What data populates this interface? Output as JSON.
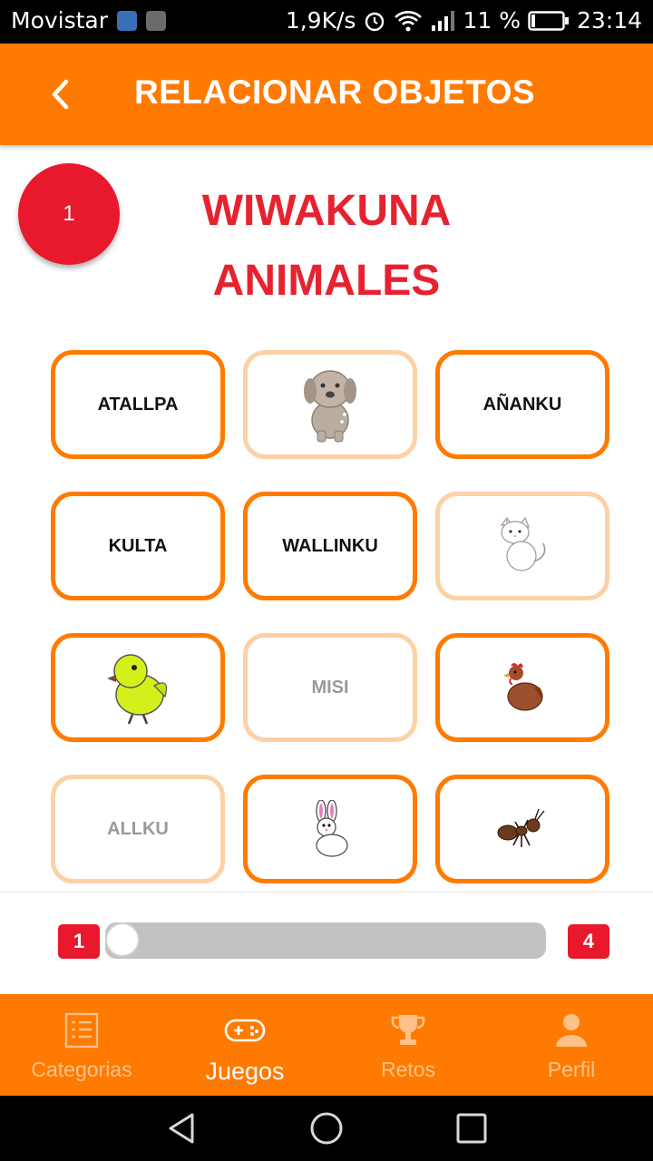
{
  "status_bar": {
    "carrier": "Movistar",
    "net_speed": "1,9K/s",
    "battery": "11 %",
    "time": "23:14"
  },
  "app_bar": {
    "title": "RELACIONAR OBJETOS",
    "back_icon": "chevron-left-icon"
  },
  "level": {
    "number": "1"
  },
  "heading": {
    "quechua": "WIWAKUNA",
    "spanish": "ANIMALES"
  },
  "cards": [
    {
      "type": "text",
      "label": "ATALLPA",
      "faded": false
    },
    {
      "type": "image",
      "icon": "dog-icon",
      "faded": true
    },
    {
      "type": "text",
      "label": "AÑANKU",
      "faded": false
    },
    {
      "type": "text",
      "label": "KULTA",
      "faded": false
    },
    {
      "type": "text",
      "label": "WALLINKU",
      "faded": false
    },
    {
      "type": "image",
      "icon": "cat-icon",
      "faded": true
    },
    {
      "type": "image",
      "icon": "chick-icon",
      "faded": false
    },
    {
      "type": "text",
      "label": "MISI",
      "faded": true
    },
    {
      "type": "image",
      "icon": "hen-icon",
      "faded": false
    },
    {
      "type": "text",
      "label": "ALLKU",
      "faded": true
    },
    {
      "type": "image",
      "icon": "rabbit-icon",
      "faded": false
    },
    {
      "type": "image",
      "icon": "ant-icon",
      "faded": false
    }
  ],
  "progress": {
    "min_label": "1",
    "max_label": "4",
    "value": 1,
    "min": 1,
    "max": 4
  },
  "bottom_nav": [
    {
      "label": "Categorias",
      "icon": "list-icon",
      "active": false
    },
    {
      "label": "Juegos",
      "icon": "gamepad-icon",
      "active": true
    },
    {
      "label": "Retos",
      "icon": "trophy-icon",
      "active": false
    },
    {
      "label": "Perfil",
      "icon": "person-icon",
      "active": false
    }
  ],
  "colors": {
    "primary": "#FF7A00",
    "accent_red": "#E8192C",
    "faded_border": "#FDD1A7"
  }
}
